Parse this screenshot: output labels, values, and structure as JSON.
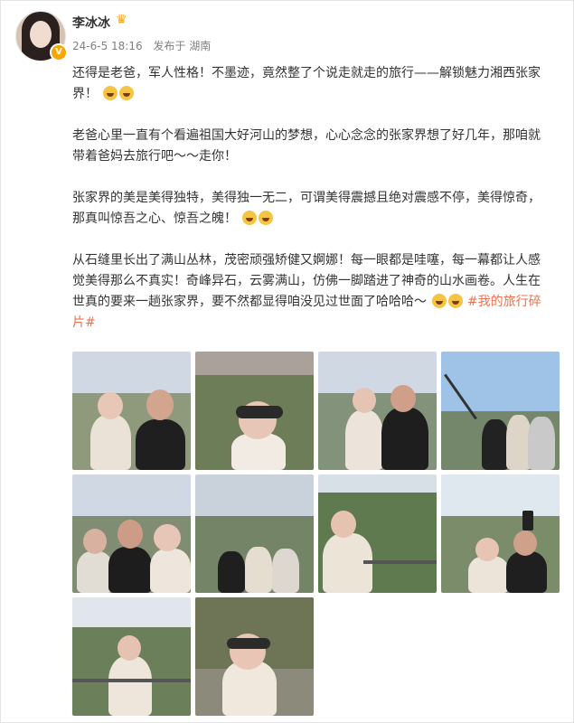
{
  "user": {
    "name": "李冰冰",
    "date": "24-6-5 18:16",
    "source": "发布于 湖南",
    "verified_icon": "v-badge-icon"
  },
  "post": {
    "p1": "还得是老爸，军人性格！不墨迹，竟然整了个说走就走的旅行——解锁魅力湘西张家界！",
    "p2": "老爸心里一直有个看遍祖国大好河山的梦想，心心念念的张家界想了好几年，那咱就带着爸妈去旅行吧～～走你！",
    "p3": "张家界的美是美得独特，美得独一无二，可谓美得震撼且绝对震感不停，美得惊奇，那真叫惊吾之心、惊吾之魄！",
    "p4": "从石缝里长出了满山丛林，茂密顽强矫健又婀娜！每一眼都是哇噻，每一幕都让人感觉美得那么不真实！奇峰异石，云雾满山，仿佛一脚踏进了神奇的山水画卷。人生在世真的要来一趟张家界，要不然都显得咱没见过世面了哈哈哈～",
    "tag": "#我的旅行碎片#"
  },
  "colors": {
    "accent": "#eb7350",
    "meta": "#808080",
    "text": "#333333"
  },
  "photos": [
    "photo-1",
    "photo-2",
    "photo-3",
    "photo-4",
    "photo-5",
    "photo-6",
    "photo-7",
    "photo-8",
    "photo-9",
    "photo-10"
  ]
}
